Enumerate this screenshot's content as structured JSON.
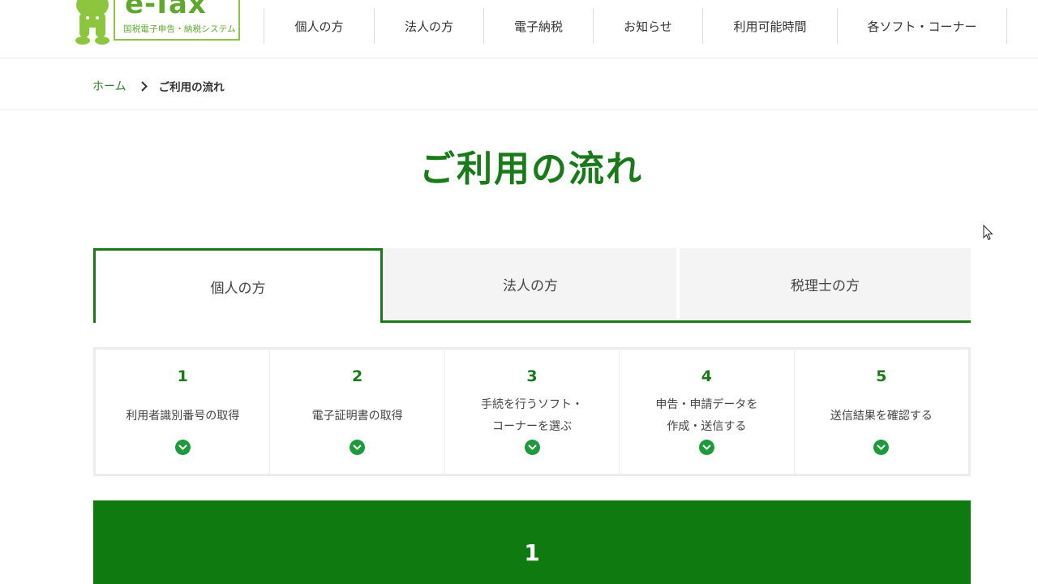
{
  "header": {
    "logo": {
      "word": "e-Tax",
      "subtitle": "国税電子申告・納税システム"
    },
    "nav": [
      {
        "label": "個人の方"
      },
      {
        "label": "法人の方"
      },
      {
        "label": "電子納税"
      },
      {
        "label": "お知らせ"
      },
      {
        "label": "利用可能時間"
      },
      {
        "label": "各ソフト・コーナー"
      }
    ]
  },
  "breadcrumb": {
    "home": "ホーム",
    "current": "ご利用の流れ"
  },
  "page": {
    "title": "ご利用の流れ"
  },
  "tabs": [
    {
      "label": "個人の方",
      "active": true
    },
    {
      "label": "法人の方",
      "active": false
    },
    {
      "label": "税理士の方",
      "active": false
    }
  ],
  "steps": [
    {
      "num": "1",
      "line1": "利用者識別番号の取得",
      "line2": ""
    },
    {
      "num": "2",
      "line1": "電子証明書の取得",
      "line2": ""
    },
    {
      "num": "3",
      "line1": "手続を行うソフト・",
      "line2": "コーナーを選ぶ"
    },
    {
      "num": "4",
      "line1": "申告・申請データを",
      "line2": "作成・送信する"
    },
    {
      "num": "5",
      "line1": "送信結果を確認する",
      "line2": ""
    }
  ],
  "section": {
    "num": "1"
  },
  "colors": {
    "brand_green": "#1a7a1a",
    "logo_green": "#8cc63f",
    "icon_green": "#1e9a3c"
  }
}
